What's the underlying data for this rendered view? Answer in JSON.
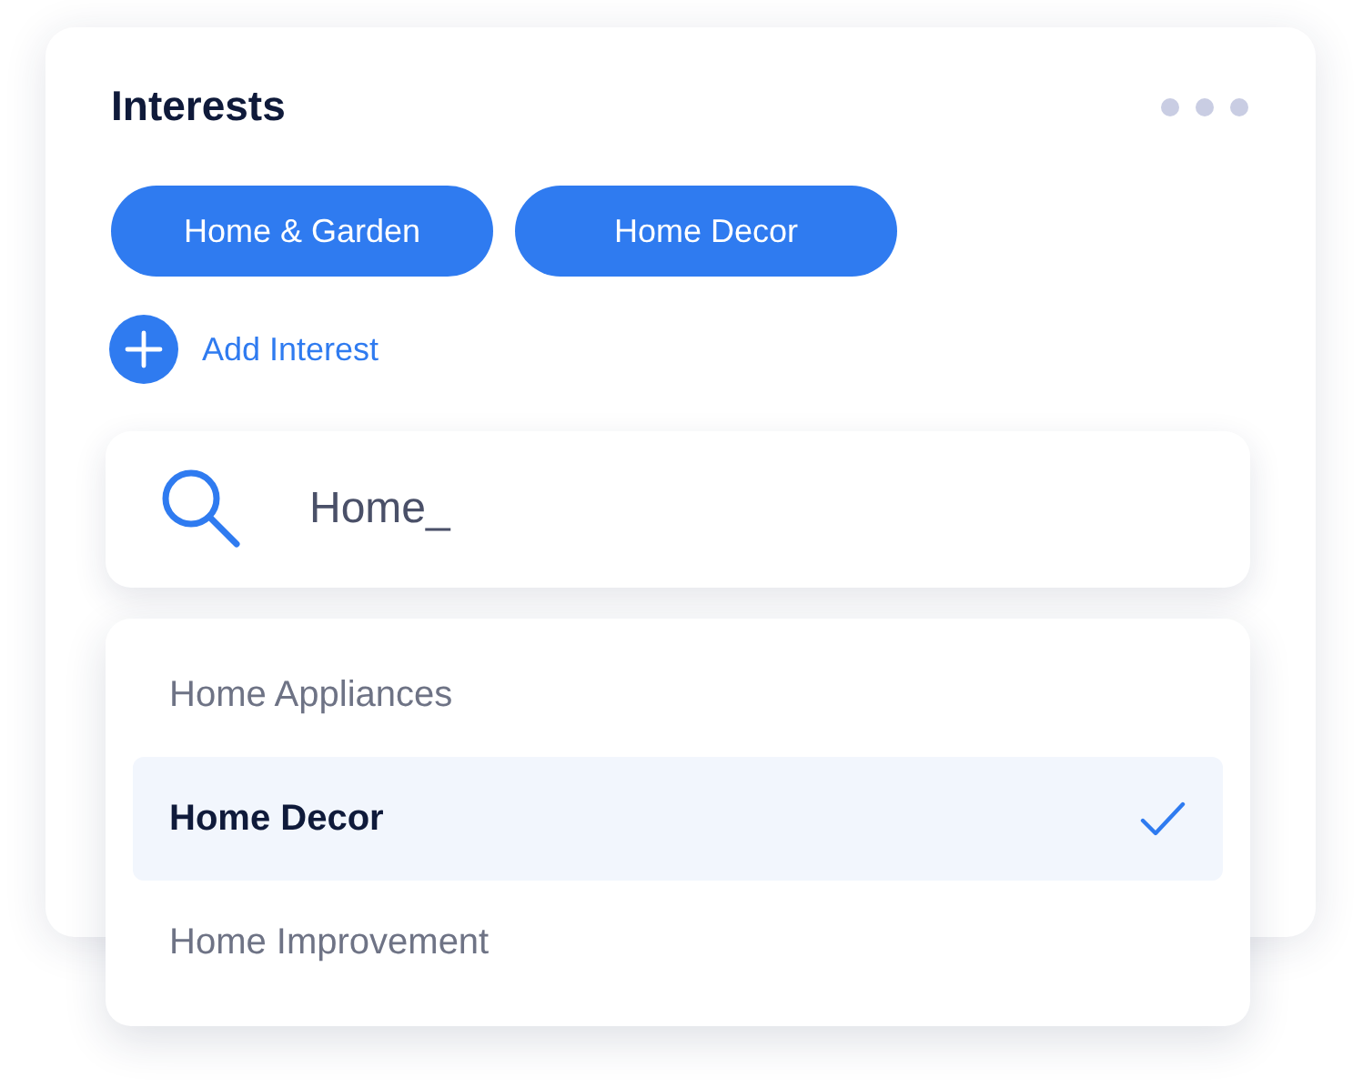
{
  "card": {
    "title": "Interests"
  },
  "tags": [
    {
      "label": "Home & Garden"
    },
    {
      "label": "Home Decor"
    }
  ],
  "add_button": {
    "label": "Add Interest"
  },
  "search": {
    "value": "Home_"
  },
  "options": [
    {
      "label": "Home Appliances",
      "selected": false
    },
    {
      "label": "Home Decor",
      "selected": true
    },
    {
      "label": "Home Improvement",
      "selected": false
    }
  ]
}
